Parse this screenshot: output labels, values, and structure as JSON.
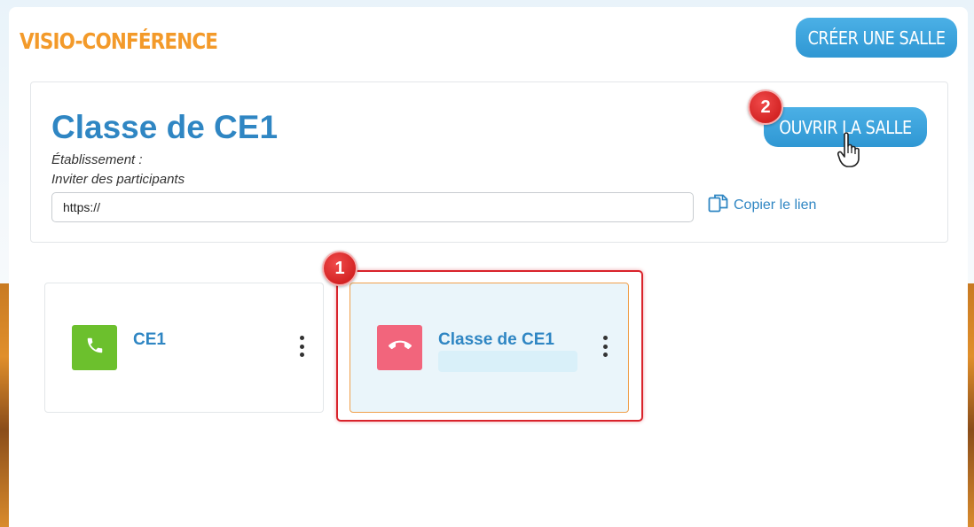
{
  "header": {
    "app_title": "VISIO-CONFÉRENCE",
    "create_room_label": "CRÉER UNE SALLE"
  },
  "room": {
    "title": "Classe de CE1",
    "establishment_label": "Établissement :",
    "invite_label": "Inviter des participants",
    "invite_url": "https://",
    "copy_link_label": "Copier le lien",
    "open_room_label": "OUVRIR LA SALLE"
  },
  "annotations": {
    "badge_1": "1",
    "badge_2": "2"
  },
  "room_cards": [
    {
      "name": "CE1",
      "call_state": "active",
      "icon": "phone-icon"
    },
    {
      "name": "Classe de CE1",
      "call_state": "hangup",
      "icon": "phone-hangup-icon"
    }
  ],
  "colors": {
    "accent_orange": "#f39a2a",
    "accent_blue": "#2f86c3",
    "call_green": "#6cc02d",
    "call_red": "#f2657c",
    "highlight_red": "#d9232b"
  }
}
